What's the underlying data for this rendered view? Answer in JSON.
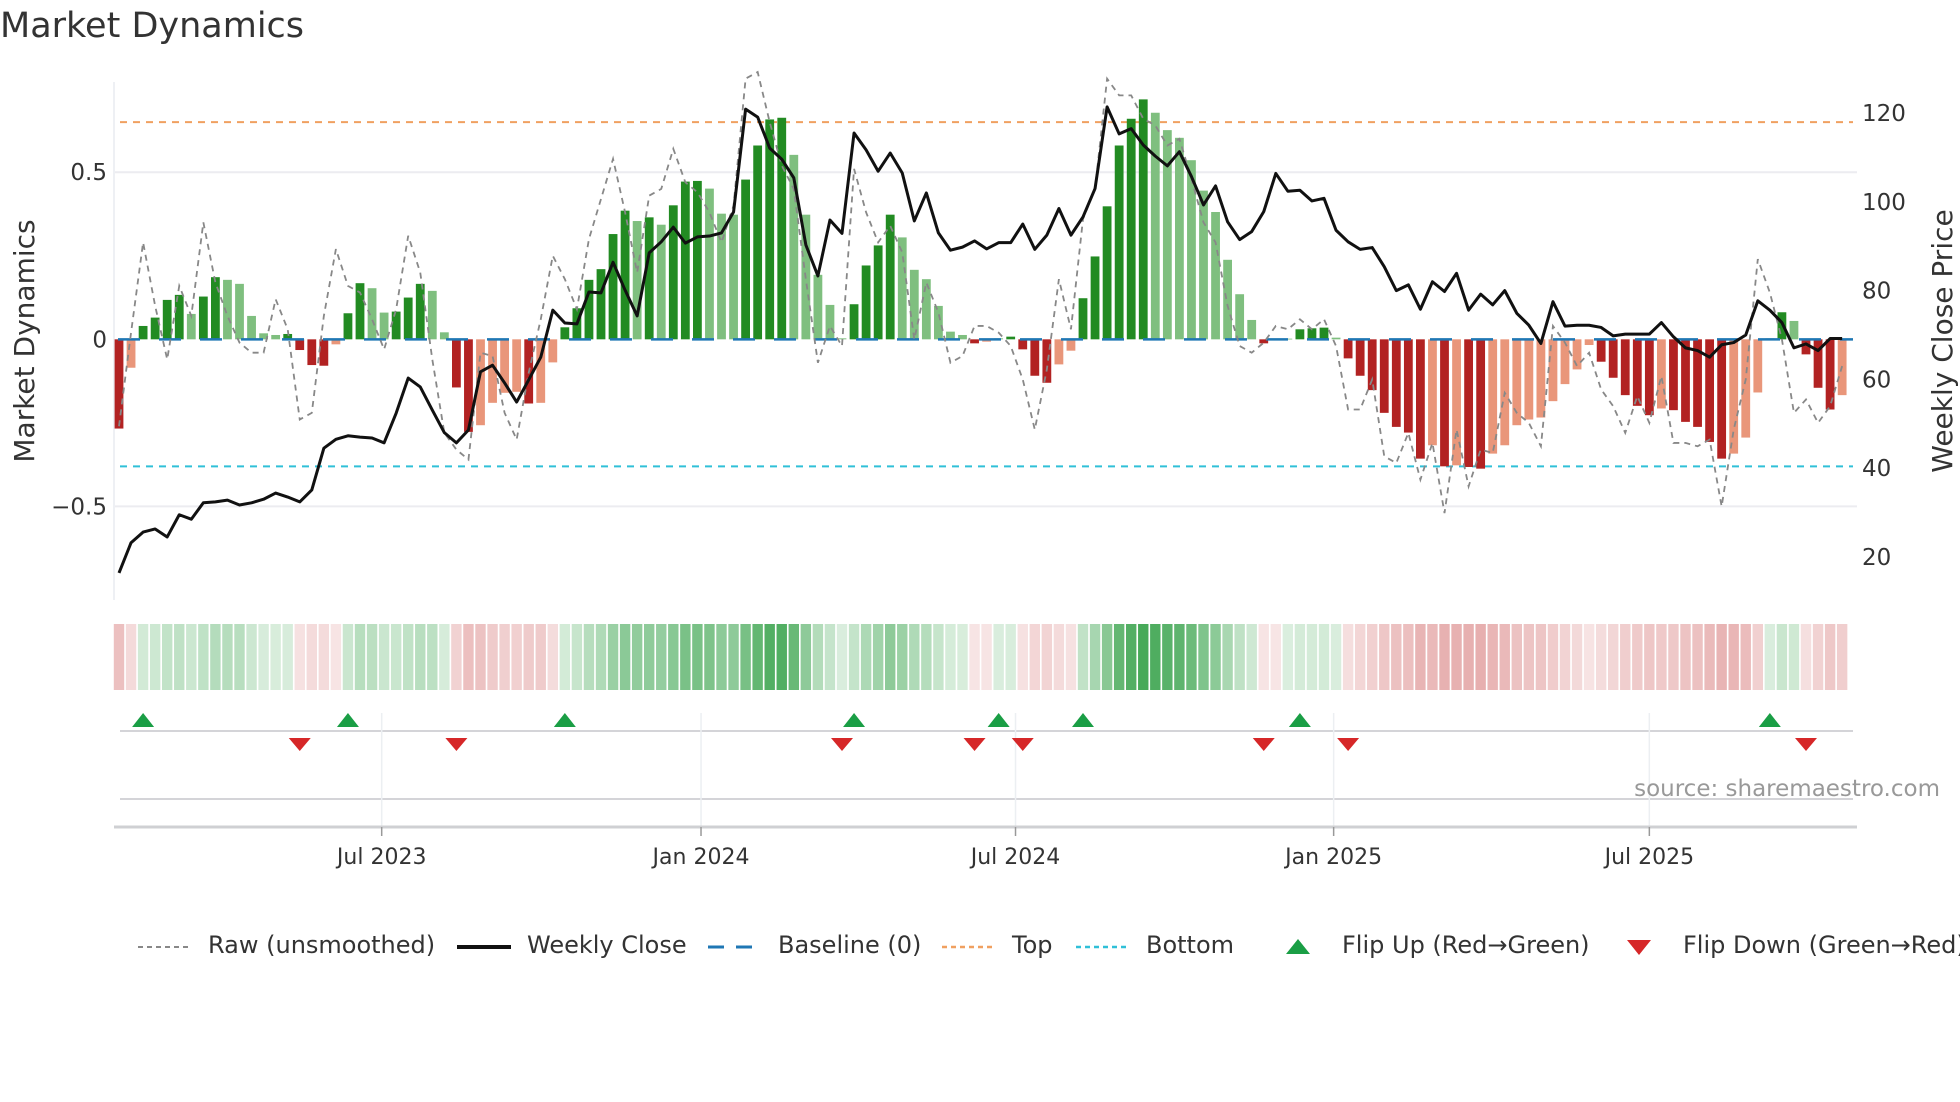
{
  "title": "Market Dynamics",
  "source": "source: sharemaestro.com",
  "colors": {
    "up_strong": "#228b22",
    "up_weak": "#7fbf7f",
    "down_strong": "#b22222",
    "down_weak": "#e9967a",
    "close": "#111111",
    "raw": "#888888",
    "baseline": "#1f77b4",
    "top": "#f0a060",
    "bottom": "#30c0d8",
    "flip_up": "#1a9e45",
    "flip_down": "#d62728"
  },
  "chart_data": {
    "type": "bar",
    "title": "Market Dynamics",
    "xlabel": "",
    "ylabel": "Market Dynamics",
    "y2label": "Weekly Close Price",
    "ylim": [
      -0.78,
      0.77
    ],
    "y2lim": [
      10.3,
      127
    ],
    "yticks": [
      {
        "v": 0.5,
        "label": "0.5"
      },
      {
        "v": 0,
        "label": "0"
      },
      {
        "v": -0.5,
        "label": "−0.5"
      }
    ],
    "y2ticks": [
      {
        "v": 120,
        "label": "120"
      },
      {
        "v": 100,
        "label": "100"
      },
      {
        "v": 80,
        "label": "80"
      },
      {
        "v": 60,
        "label": "60"
      },
      {
        "v": 40,
        "label": "40"
      },
      {
        "v": 20,
        "label": "20"
      }
    ],
    "xticks": [
      {
        "week": 21.8,
        "label": "Jul 2023"
      },
      {
        "week": 48.3,
        "label": "Jan 2024"
      },
      {
        "week": 74.4,
        "label": "Jul 2024"
      },
      {
        "week": 100.8,
        "label": "Jan 2025"
      },
      {
        "week": 127.0,
        "label": "Jul 2025"
      }
    ],
    "top_level": 0.65,
    "bottom_level": -0.38,
    "baseline": 0,
    "dynamics": [
      -0.267,
      -0.085,
      0.04,
      0.065,
      0.118,
      0.133,
      0.076,
      0.128,
      0.186,
      0.178,
      0.166,
      0.07,
      0.018,
      0.013,
      0.016,
      -0.032,
      -0.077,
      -0.079,
      -0.015,
      0.078,
      0.168,
      0.153,
      0.08,
      0.083,
      0.125,
      0.166,
      0.145,
      0.021,
      -0.144,
      -0.277,
      -0.257,
      -0.19,
      -0.16,
      -0.157,
      -0.192,
      -0.19,
      -0.069,
      0.036,
      0.093,
      0.178,
      0.21,
      0.315,
      0.385,
      0.354,
      0.365,
      0.343,
      0.401,
      0.472,
      0.474,
      0.451,
      0.376,
      0.373,
      0.478,
      0.58,
      0.658,
      0.663,
      0.552,
      0.373,
      0.193,
      0.103,
      0.003,
      0.105,
      0.221,
      0.281,
      0.373,
      0.305,
      0.208,
      0.18,
      0.1,
      0.023,
      0.013,
      -0.012,
      -0.007,
      0.003,
      0.008,
      -0.03,
      -0.109,
      -0.13,
      -0.075,
      -0.034,
      0.123,
      0.248,
      0.398,
      0.58,
      0.66,
      0.718,
      0.678,
      0.626,
      0.603,
      0.536,
      0.445,
      0.381,
      0.238,
      0.135,
      0.058,
      -0.012,
      -0.003,
      0.002,
      0.03,
      0.033,
      0.035,
      0.005,
      -0.057,
      -0.109,
      -0.152,
      -0.22,
      -0.262,
      -0.279,
      -0.357,
      -0.317,
      -0.38,
      -0.377,
      -0.382,
      -0.387,
      -0.342,
      -0.317,
      -0.257,
      -0.24,
      -0.234,
      -0.185,
      -0.134,
      -0.09,
      -0.017,
      -0.067,
      -0.115,
      -0.167,
      -0.199,
      -0.227,
      -0.207,
      -0.212,
      -0.247,
      -0.262,
      -0.307,
      -0.357,
      -0.342,
      -0.294,
      -0.159,
      0.003,
      0.081,
      0.055,
      -0.045,
      -0.145,
      -0.21,
      -0.167
    ],
    "shade": "DLDDDDLDDLLLLLDDDDLDDLLDDDLLDDLLLLDLLDDDDDDLDLDDDLLLDDDDLLLLLDDDDLLLLLLDLLDDDDLLDDDDDDLLLLLLLLLDLLDDDLDDDDDDDLDLDDLLLLLLLLLDDDDDLDDDDDLLLLDLDDDL",
    "raw": [
      -0.26,
      0.02,
      0.29,
      0.1,
      -0.06,
      0.16,
      0.07,
      0.35,
      0.17,
      0.07,
      -0.01,
      -0.04,
      -0.04,
      0.12,
      0.03,
      -0.24,
      -0.22,
      0.07,
      0.27,
      0.16,
      0.14,
      0.06,
      -0.03,
      0.09,
      0.31,
      0.2,
      -0.06,
      -0.28,
      -0.33,
      -0.36,
      -0.04,
      -0.05,
      -0.22,
      -0.3,
      -0.1,
      0.06,
      0.25,
      0.18,
      0.09,
      0.3,
      0.42,
      0.54,
      0.38,
      0.2,
      0.43,
      0.45,
      0.57,
      0.47,
      0.44,
      0.38,
      0.29,
      0.4,
      0.78,
      0.8,
      0.65,
      0.52,
      0.45,
      0.18,
      -0.07,
      0.04,
      -0.02,
      0.51,
      0.38,
      0.29,
      0.34,
      0.26,
      0,
      0.17,
      0.08,
      -0.07,
      -0.05,
      0.04,
      0.04,
      0.02,
      -0.02,
      -0.12,
      -0.27,
      -0.09,
      0.18,
      0.03,
      0.36,
      0.45,
      0.78,
      0.73,
      0.73,
      0.66,
      0.64,
      0.58,
      0.6,
      0.48,
      0.35,
      0.29,
      0.1,
      -0.02,
      -0.04,
      -0.01,
      0.04,
      0.03,
      0.06,
      0.03,
      0.06,
      -0.02,
      -0.21,
      -0.21,
      -0.12,
      -0.35,
      -0.37,
      -0.28,
      -0.42,
      -0.31,
      -0.52,
      -0.27,
      -0.44,
      -0.33,
      -0.34,
      -0.16,
      -0.22,
      -0.25,
      -0.32,
      0.04,
      -0.01,
      -0.08,
      -0.04,
      -0.15,
      -0.2,
      -0.28,
      -0.17,
      -0.25,
      -0.11,
      -0.31,
      -0.31,
      -0.32,
      -0.3,
      -0.5,
      -0.27,
      -0.12,
      0.24,
      0.14,
      0,
      -0.22,
      -0.18,
      -0.25,
      -0.2,
      -0.08
    ],
    "close": [
      16.4,
      23.2,
      25.6,
      26.3,
      24.5,
      29.5,
      28.5,
      32.2,
      32.4,
      32.8,
      31.7,
      32.2,
      33,
      34.4,
      33.5,
      32.4,
      35.1,
      44.5,
      46.5,
      47.3,
      47,
      46.8,
      45.7,
      52.4,
      60.3,
      58.3,
      53.1,
      48,
      45.7,
      48.6,
      61.7,
      63.2,
      59.2,
      54.9,
      59.9,
      65,
      75.6,
      72.7,
      72.5,
      79.7,
      79.5,
      86.4,
      80.1,
      74.3,
      88.5,
      91,
      94.3,
      90.7,
      92.1,
      92.3,
      93,
      97.7,
      120.9,
      119.1,
      112.1,
      109.6,
      105.4,
      90.3,
      83.3,
      95.9,
      92.9,
      115.5,
      111.7,
      106.9,
      111,
      106.5,
      95.7,
      102,
      93,
      89.1,
      89.8,
      91.2,
      89.4,
      90.8,
      90.8,
      95,
      89.3,
      92.5,
      98.5,
      92.5,
      96.6,
      103,
      121.4,
      115.3,
      116.5,
      112.8,
      110.3,
      108.1,
      111.3,
      105.7,
      99.3,
      103.6,
      95.5,
      91.5,
      93.3,
      97.8,
      106.4,
      102.4,
      102.6,
      100.2,
      100.8,
      93.6,
      91,
      89.3,
      89.7,
      85.4,
      80,
      81.3,
      75.8,
      82,
      79.8,
      83.9,
      75.6,
      79.2,
      76.8,
      80,
      74.9,
      72.2,
      68.1,
      77.5,
      72,
      72.2,
      72.2,
      71.7,
      69.8,
      70.2,
      70.2,
      70.2,
      72.8,
      69.6,
      67.1,
      66.5,
      65,
      67.8,
      68.3,
      70,
      77.7,
      75.6,
      72.8,
      67.1,
      68,
      66.5,
      69.2,
      69.2
    ],
    "flip_up_weeks": [
      2,
      19,
      37,
      61,
      73,
      80,
      98,
      137
    ],
    "flip_down_weeks": [
      15,
      28,
      60,
      71,
      75,
      95,
      102,
      140
    ],
    "legend": [
      {
        "key": "raw",
        "label": "Raw (unsmoothed)"
      },
      {
        "key": "close",
        "label": "Weekly Close"
      },
      {
        "key": "baseline",
        "label": "Baseline (0)"
      },
      {
        "key": "top",
        "label": "Top"
      },
      {
        "key": "bottom",
        "label": "Bottom"
      },
      {
        "key": "flip_up",
        "label": "Flip Up (Red→Green)"
      },
      {
        "key": "flip_down",
        "label": "Flip Down (Green→Red)"
      }
    ],
    "legend_position": "bottom"
  }
}
